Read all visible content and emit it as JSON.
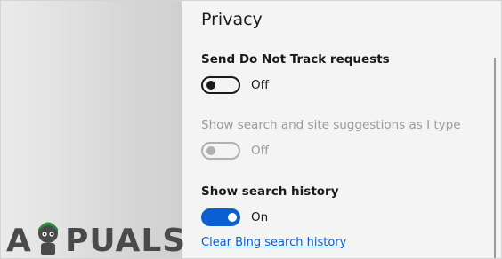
{
  "privacy": {
    "title": "Privacy",
    "settings": [
      {
        "label": "Send Do Not Track requests",
        "state": "Off",
        "on": false,
        "enabled": true
      },
      {
        "label": "Show search and site suggestions as I type",
        "state": "Off",
        "on": false,
        "enabled": false
      },
      {
        "label": "Show search history",
        "state": "On",
        "on": true,
        "enabled": true
      }
    ],
    "clear_link": "Clear Bing search history"
  },
  "watermark": {
    "text": "APPUALS"
  },
  "colors": {
    "accent": "#0b5fd0",
    "pane_bg": "#f4f4f4",
    "disabled": "#9a9a9a"
  }
}
